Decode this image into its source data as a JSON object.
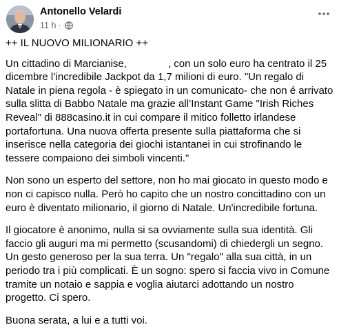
{
  "post": {
    "author": "Antonello Velardi",
    "time": "11 h",
    "separator": "·",
    "audience_icon": "globe-icon",
    "more_icon": "more-dots-icon",
    "title": "++ IL NUOVO MILIONARIO ++",
    "p1_a": "Un cittadino di Marcianise,",
    "p1_b": ", con un solo euro ha centrato il 25 dicembre l’incredibile Jackpot da 1,7 milioni di euro. \"Un regalo di Natale in piena regola - è  spiegato in un comunicato- che non é arrivato sulla slitta di Babbo Natale ma grazie all’Instant Game \"Irish Riches Reveal\" di 888casino.it in cui compare il mitico folletto irlandese portafortuna. Una nuova offerta presente sulla piattaforma che si inserisce nella categoria dei giochi istantanei in cui strofinando le tessere compaiono dei simboli vincenti.\"",
    "p2": "Non sono un esperto del settore, non ho mai giocato in questo modo e non ci capisco nulla. Però ho capito che un nostro concittadino con un euro è diventato milionario, il giorno di Natale. Un'incredibile fortuna.",
    "p3": "Il giocatore è anonimo, nulla si sa ovviamente sulla sua identità. Gli faccio gli auguri ma mi permetto (scusandomi) di chiedergli un segno. Un gesto generoso per la sua terra. Un \"regalo\" alla sua città, in un periodo tra i più complicati. È un sogno: spero si faccia vivo in Comune tramite un notaio e sappia e voglia aiutarci adottando un nostro progetto. Ci spero.",
    "p4": "Buona serata, a lui e a tutti voi."
  },
  "colors": {
    "text": "#050505",
    "meta": "#65676b",
    "background": "#ffffff"
  }
}
